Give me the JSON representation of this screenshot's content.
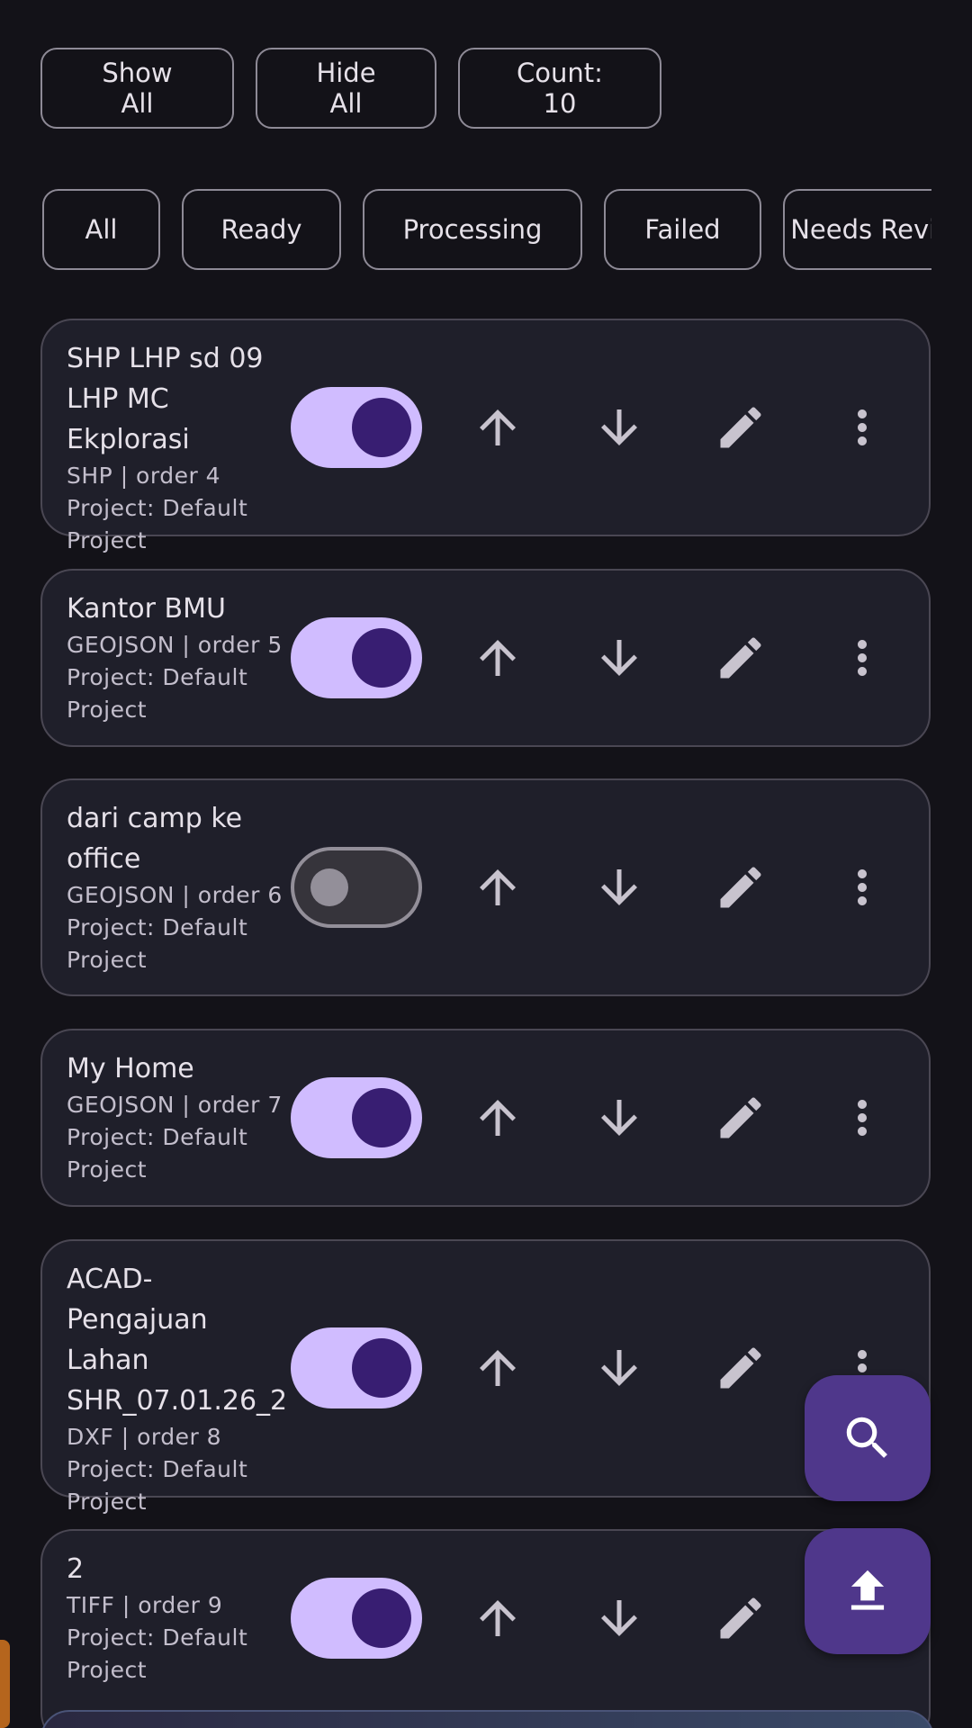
{
  "actions": {
    "show_all": "Show All",
    "hide_all": "Hide All",
    "count": "Count: 10"
  },
  "filters": [
    "All",
    "Ready",
    "Processing",
    "Failed",
    "Needs Review"
  ],
  "layers": [
    {
      "title_lines": [
        "SHP LHP sd 09",
        "LHP MC Ekplorasi"
      ],
      "meta": "SHP | order 4",
      "project_lines": [
        "Project: Default",
        "Project"
      ],
      "visible": true
    },
    {
      "title_lines": [
        "Kantor BMU"
      ],
      "meta": "GEOJSON | order 5",
      "project_lines": [
        "Project: Default",
        "Project"
      ],
      "visible": true
    },
    {
      "title_lines": [
        "dari camp ke",
        "office"
      ],
      "meta": "GEOJSON | order 6",
      "project_lines": [
        "Project: Default",
        "Project"
      ],
      "visible": false
    },
    {
      "title_lines": [
        "My Home"
      ],
      "meta": "GEOJSON | order 7",
      "project_lines": [
        "Project: Default",
        "Project"
      ],
      "visible": true
    },
    {
      "title_lines": [
        "ACAD-Pengajuan",
        "Lahan",
        "SHR_07.01.26_2"
      ],
      "meta": "DXF | order 8",
      "project_lines": [
        "Project: Default",
        "Project"
      ],
      "visible": true
    },
    {
      "title_lines": [
        "2"
      ],
      "meta": "TIFF | order 9",
      "project_lines": [
        "Project: Default",
        "Project"
      ],
      "visible": true
    }
  ],
  "icons": {
    "up": "arrow-upward-icon",
    "down": "arrow-downward-icon",
    "edit": "pencil-icon",
    "more": "more-vert-icon",
    "search": "search-icon",
    "upload": "upload-icon"
  },
  "colors": {
    "background": "#131218",
    "card": "#1F1F2A",
    "switch_on_track": "#D0BCFF",
    "switch_on_thumb": "#381E72",
    "fab": "#4F378B",
    "icon": "#C8C3CE"
  }
}
